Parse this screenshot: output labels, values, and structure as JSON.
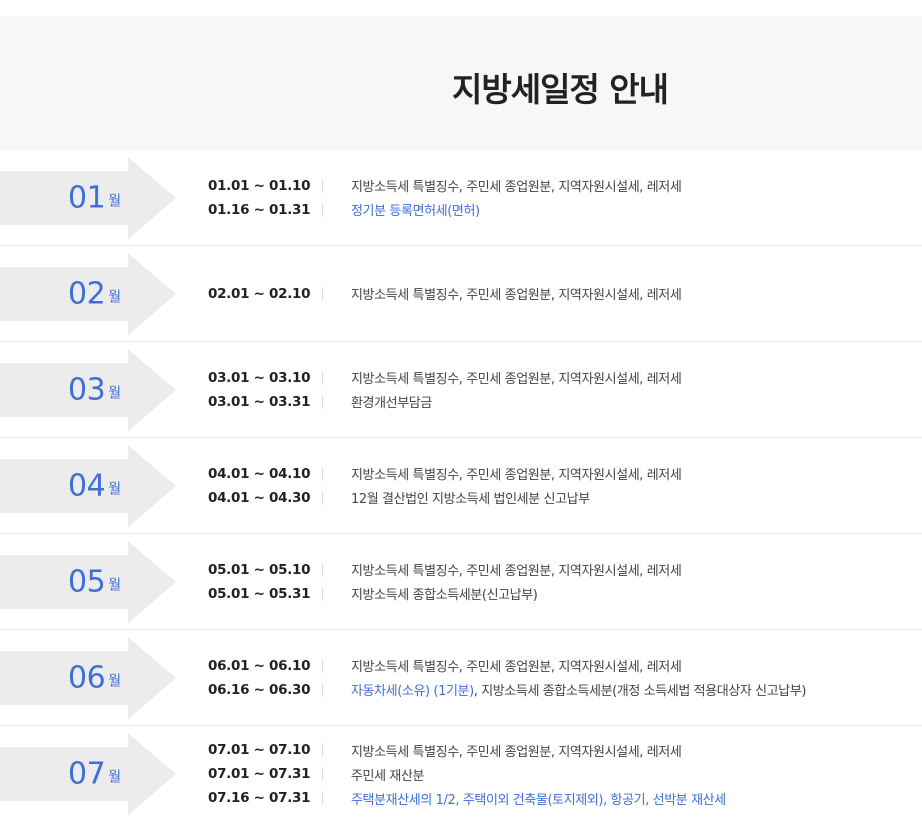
{
  "page": {
    "title": "지방세일정 안내"
  },
  "colors": {
    "accent": "#3f6fd6",
    "arrow": "#ececec"
  },
  "months": [
    {
      "num": "01",
      "unit": "월",
      "entries": [
        {
          "date": "01.01 ~ 01.10",
          "desc": "지방소득세 특별징수, 주민세 종업원분, 지역자원시설세, 레저세"
        },
        {
          "date": "01.16 ~ 01.31",
          "desc": "정기분 등록면허세(면허)",
          "blue": true
        }
      ]
    },
    {
      "num": "02",
      "unit": "월",
      "entries": [
        {
          "date": "02.01 ~ 02.10",
          "desc": "지방소득세 특별징수, 주민세 종업원분, 지역자원시설세, 레저세"
        }
      ]
    },
    {
      "num": "03",
      "unit": "월",
      "entries": [
        {
          "date": "03.01 ~ 03.10",
          "desc": "지방소득세 특별징수, 주민세 종업원분, 지역자원시설세, 레저세"
        },
        {
          "date": "03.01 ~ 03.31",
          "desc": "환경개선부담금"
        }
      ]
    },
    {
      "num": "04",
      "unit": "월",
      "entries": [
        {
          "date": "04.01 ~ 04.10",
          "desc": "지방소득세 특별징수, 주민세 종업원분, 지역자원시설세, 레저세"
        },
        {
          "date": "04.01 ~ 04.30",
          "desc": "12월 결산법인 지방소득세 법인세분 신고납부"
        }
      ]
    },
    {
      "num": "05",
      "unit": "월",
      "entries": [
        {
          "date": "05.01 ~ 05.10",
          "desc": "지방소득세 특별징수, 주민세 종업원분, 지역자원시설세, 레저세"
        },
        {
          "date": "05.01 ~ 05.31",
          "desc": "지방소득세 종합소득세분(신고납부)"
        }
      ]
    },
    {
      "num": "06",
      "unit": "월",
      "entries": [
        {
          "date": "06.01 ~ 06.10",
          "desc": "지방소득세 특별징수, 주민세 종업원분, 지역자원시설세, 레저세"
        },
        {
          "date": "06.16 ~ 06.30",
          "desc_blue": "자동차세(소유) (1기분)",
          "desc": ", 지방소득세 종합소득세분(개정 소득세법 적용대상자 신고납부)"
        }
      ]
    },
    {
      "num": "07",
      "unit": "월",
      "entries": [
        {
          "date": "07.01 ~ 07.10",
          "desc": "지방소득세 특별징수, 주민세 종업원분, 지역자원시설세, 레저세"
        },
        {
          "date": "07.01 ~ 07.31",
          "desc": "주민세 재산분"
        },
        {
          "date": "07.16 ~ 07.31",
          "desc": "주택분재산세의 1/2, 주택이외 건축물(토지제외), 항공기, 선박분 재산세",
          "blue": true
        }
      ]
    }
  ]
}
